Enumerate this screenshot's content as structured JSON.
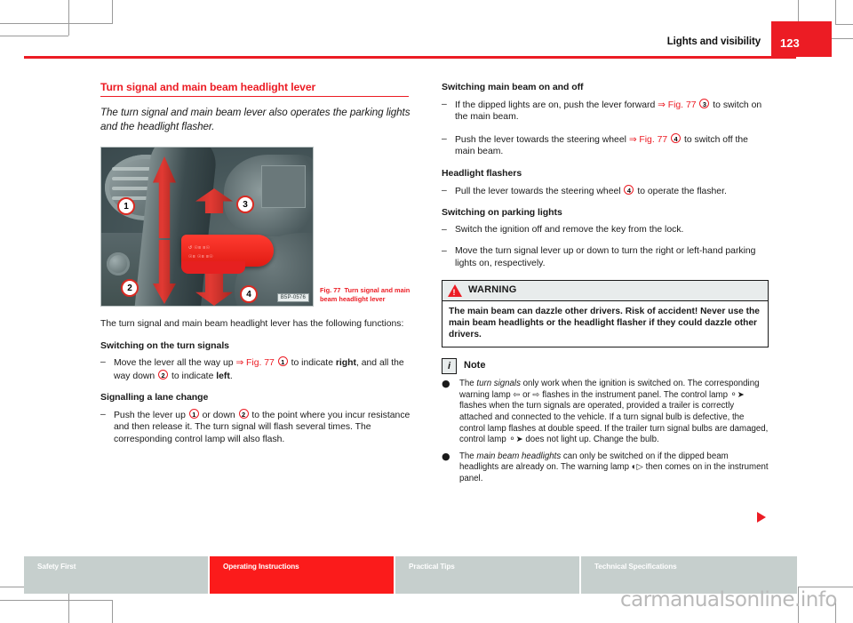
{
  "header": {
    "title": "Lights and visibility",
    "page_number": "123"
  },
  "left_column": {
    "section_title": "Turn signal and main beam headlight lever",
    "lead": "The turn signal and main beam lever also operates the parking lights and the headlight flasher.",
    "intro": "The turn signal and main beam headlight lever has the following functions:",
    "sub_turn_signals": "Switching on the turn signals",
    "turn_signals_item_pre": "Move the lever all the way up ",
    "turn_signals_xref": "⇒ Fig. 77",
    "turn_signals_num1": "1",
    "turn_signals_mid": " to indicate ",
    "turn_signals_right": "right",
    "turn_signals_mid2": ", and all the way down ",
    "turn_signals_num2": "2",
    "turn_signals_mid3": " to indicate ",
    "turn_signals_left": "left",
    "turn_signals_end": ".",
    "sub_lane_change": "Signalling a lane change",
    "lane_change_pre": "Push the lever up ",
    "lane_change_num1": "1",
    "lane_change_mid": " or down ",
    "lane_change_num2": "2",
    "lane_change_end": " to the point where you incur resistance and then release it. The turn signal will flash several times. The corresponding control lamp will also flash."
  },
  "figure": {
    "caption_label": "Fig. 77",
    "caption_text": "Turn signal and main beam headlight lever",
    "image_code": "B5P-0576",
    "callouts": [
      "1",
      "2",
      "3",
      "4"
    ],
    "lever_symbols_row1": "↺   ☉≡   ≡☉",
    "lever_symbols_row2": "☉≡   ☉≡   ≡☉"
  },
  "right_column": {
    "sub_main_beam": "Switching main beam on and off",
    "main_beam_item1_pre": "If the dipped lights are on, push the lever forward ",
    "main_beam_item1_xref": "⇒ Fig. 77",
    "main_beam_item1_num": "3",
    "main_beam_item1_end": " to switch on the main beam.",
    "main_beam_item2_pre": "Push the lever towards the steering wheel ",
    "main_beam_item2_xref": "⇒ Fig. 77",
    "main_beam_item2_num": "4",
    "main_beam_item2_end": " to switch off the main beam.",
    "sub_flashers": "Headlight flashers",
    "flashers_pre": "Pull the lever towards the steering wheel ",
    "flashers_num": "4",
    "flashers_end": " to operate the flasher.",
    "sub_parking": "Switching on parking lights",
    "parking_item1": "Switch the ignition off and remove the key from the lock.",
    "parking_item2": "Move the turn signal lever up or down to turn the right or left-hand parking lights on, respectively."
  },
  "warning": {
    "title": "WARNING",
    "body": "The main beam can dazzle other drivers. Risk of accident! Never use the main beam headlights or the headlight flasher if they could dazzle other drivers."
  },
  "note": {
    "title": "Note",
    "icon_glyph": "i",
    "items": [
      {
        "pre": "The ",
        "italic": "turn signals",
        "post": " only work when the ignition is switched on. The corresponding warning lamp ⇦ or ⇨ flashes in the instrument panel. The control lamp ⚬➤ flashes when the turn signals are operated, provided a trailer is correctly attached and connected to the vehicle. If a turn signal bulb is defective, the control lamp flashes at double speed. If the trailer turn signal bulbs are damaged, control lamp ⚬➤ does not light up. Change the bulb."
      },
      {
        "pre": "The ",
        "italic": "main beam headlights",
        "post": " can only be switched on if the dipped beam headlights are already on. The warning lamp ◐▷ then comes on in the instrument panel."
      }
    ]
  },
  "footer": {
    "tabs": [
      {
        "label": "Safety First",
        "active": false
      },
      {
        "label": "Operating Instructions",
        "active": true
      },
      {
        "label": "Practical Tips",
        "active": false
      },
      {
        "label": "Technical Specifications",
        "active": false
      }
    ]
  },
  "watermark": "carmanualsonline.info",
  "colors": {
    "brand_red": "#ec1c24",
    "footer_grey": "#c6cfcd",
    "footer_active": "#fb1b1b"
  }
}
